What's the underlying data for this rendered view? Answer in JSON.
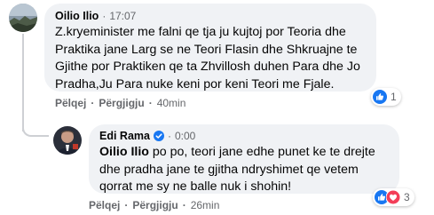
{
  "comment1": {
    "author": "Oilio Ilio",
    "separator": "·",
    "time": "17:07",
    "text": "Z.kryeminister me falni qe tja ju kujtoj por Teoria dhe Praktika jane Larg se ne Teori Flasin dhe Shkruajne te Gjithe por Praktiken qe ta Zhvillosh duhen Para dhe Jo Pradha,Ju Para nuke keni por keni Teori me Fjale.",
    "reaction_count": "1",
    "actions": {
      "like": "Pëlqej",
      "reply": "Përgjigju",
      "sep": "·",
      "age": "40min"
    }
  },
  "comment2": {
    "author": "Edi Rama",
    "separator": "·",
    "time": "0:00",
    "mention": "Oilio Ilio",
    "text": " po po, teori jane edhe punet ke te drejte dhe pradha jane te gjitha ndryshimet qe vetem qorrat me sy ne balle nuk i shohin!",
    "reaction_count": "3",
    "actions": {
      "like": "Pëlqej",
      "reply": "Përgjigju",
      "sep": "·",
      "age": "26min"
    }
  },
  "colors": {
    "bubble": "#f0f2f5",
    "meta": "#65676b",
    "like_blue": "#1877f2",
    "love_red": "#f33e58"
  },
  "icons": [
    "avatar",
    "verified-badge-icon",
    "like-reaction-icon",
    "love-reaction-icon"
  ]
}
